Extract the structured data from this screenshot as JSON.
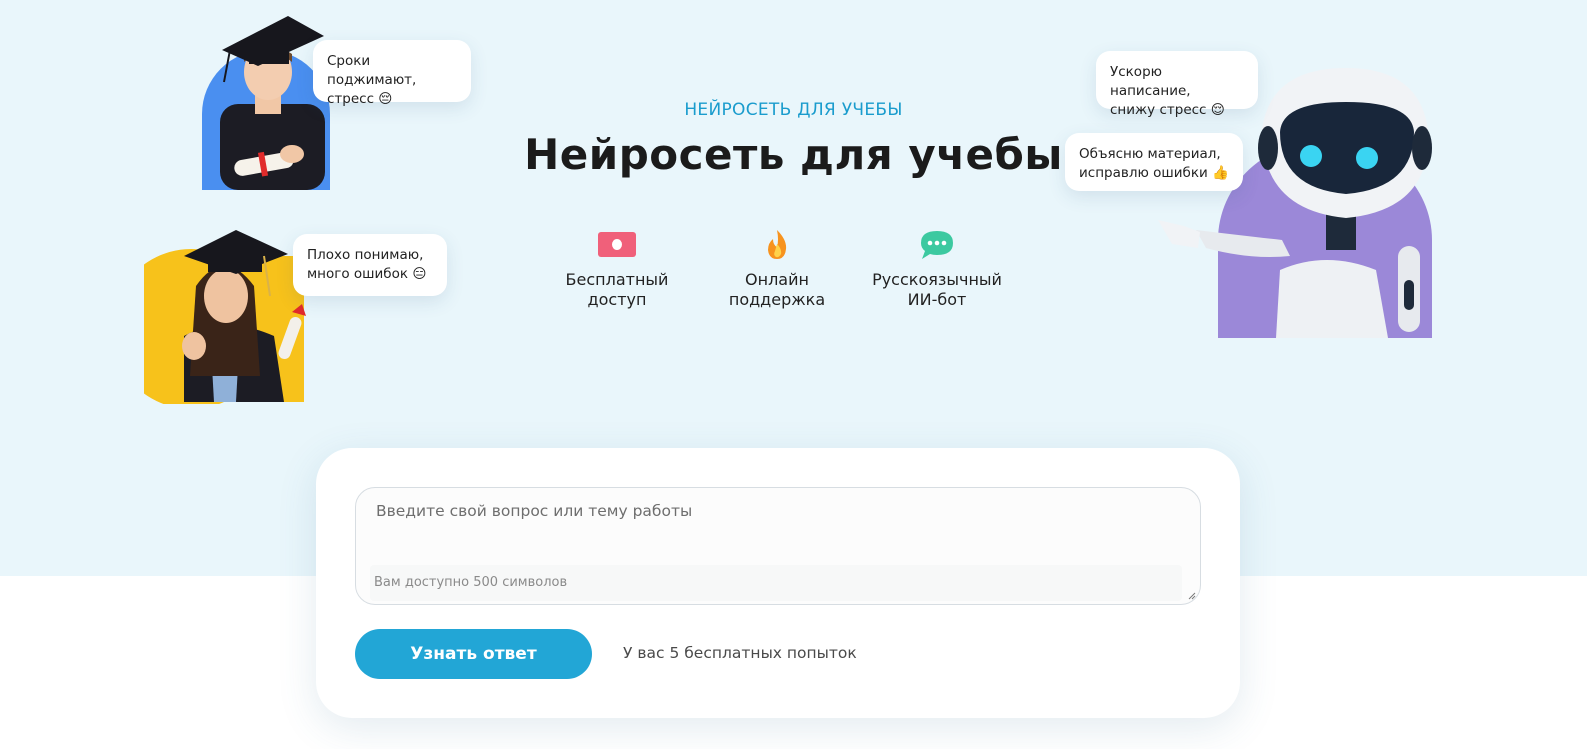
{
  "hero": {
    "eyebrow": "НЕЙРОСЕТЬ ДЛЯ УЧЕБЫ",
    "title": "Нейросеть для учебы"
  },
  "features": [
    {
      "icon": "ticket-icon",
      "label": "Бесплатный\nдоступ",
      "color": "#f0607a"
    },
    {
      "icon": "flame-icon",
      "label": "Онлайн\nподдержка",
      "color": "#f7931e"
    },
    {
      "icon": "chat-bubble-icon",
      "label": "Русскоязычный\nИИ-бот",
      "color": "#3cc9a0"
    }
  ],
  "bubbles": {
    "student_male": "Сроки поджимают,\nстресс 😔",
    "student_female": "Плохо понимаю,\nмного ошибок 😑",
    "robot_top": "Ускорю написание,\nснижу стресс 😌",
    "robot_bottom": "Объясню материал,\nисправлю ошибки 👍"
  },
  "form": {
    "placeholder": "Введите свой вопрос или тему работы",
    "char_limit": "Вам доступно 500 символов",
    "submit_label": "Узнать ответ",
    "attempts_text": "У вас 5 бесплатных попыток"
  },
  "colors": {
    "accent": "#22a6d6",
    "hero_bg": "#e9f6fb",
    "male_circle": "#4a8ff0",
    "female_circle": "#f7c21b",
    "robot_circle": "#9b88d8"
  }
}
